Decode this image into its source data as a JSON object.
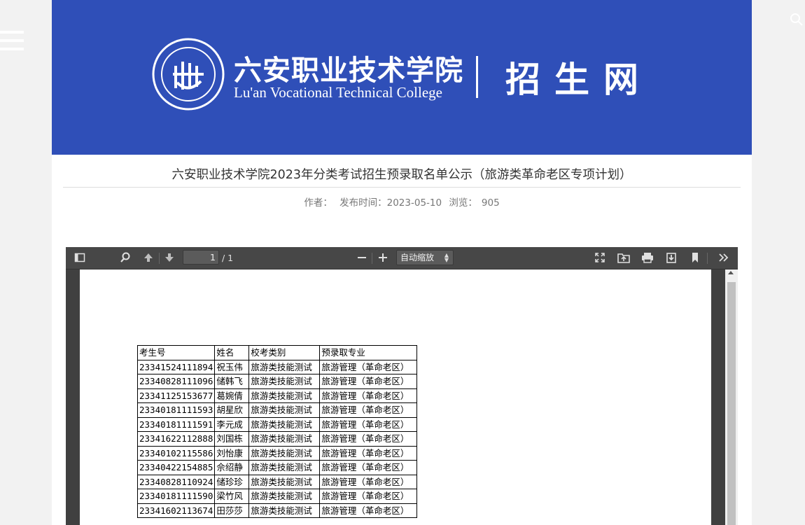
{
  "header": {
    "brand_cn": "六安职业技术学院",
    "brand_en": "Lu'an Vocational Technical College",
    "site_name": "招生网",
    "color": "#2f4fb8"
  },
  "article": {
    "title": "六安职业技术学院2023年分类考试招生预录取名单公示（旅游类革命老区专项计划）",
    "author_label": "作者：",
    "date_label": "发布时间：2023-05-10",
    "views_label": "浏览：",
    "views": "905"
  },
  "pdf_viewer": {
    "page_current": "1",
    "page_count": "/ 1",
    "zoom": "自动缩放",
    "icons": [
      "sidebar-toggle-icon",
      "search-icon",
      "arrow-up-icon",
      "arrow-down-icon",
      "zoom-out-icon",
      "zoom-in-icon",
      "fullscreen-icon",
      "open-file-icon",
      "print-icon",
      "download-icon",
      "bookmark-icon",
      "double-chevron-right-icon"
    ]
  },
  "table": {
    "headers": [
      "考生号",
      "姓名",
      "校考类别",
      "预录取专业"
    ],
    "rows": [
      [
        "23341524111894",
        "祝玉伟",
        "旅游类技能测试",
        "旅游管理（革命老区）"
      ],
      [
        "23340828111096",
        "储韩飞",
        "旅游类技能测试",
        "旅游管理（革命老区）"
      ],
      [
        "23341125153677",
        "葛婉倩",
        "旅游类技能测试",
        "旅游管理（革命老区）"
      ],
      [
        "23340181111593",
        "胡星欣",
        "旅游类技能测试",
        "旅游管理（革命老区）"
      ],
      [
        "23340181111591",
        "李元成",
        "旅游类技能测试",
        "旅游管理（革命老区）"
      ],
      [
        "23341622112888",
        "刘国栋",
        "旅游类技能测试",
        "旅游管理（革命老区）"
      ],
      [
        "23340102115586",
        "刘怡康",
        "旅游类技能测试",
        "旅游管理（革命老区）"
      ],
      [
        "23340422154885",
        "佘绍静",
        "旅游类技能测试",
        "旅游管理（革命老区）"
      ],
      [
        "23340828110924",
        "储珍珍",
        "旅游类技能测试",
        "旅游管理（革命老区）"
      ],
      [
        "23340181111590",
        "梁竹风",
        "旅游类技能测试",
        "旅游管理（革命老区）"
      ],
      [
        "23341602113674",
        "田莎莎",
        "旅游类技能测试",
        "旅游管理（革命老区）"
      ]
    ]
  }
}
